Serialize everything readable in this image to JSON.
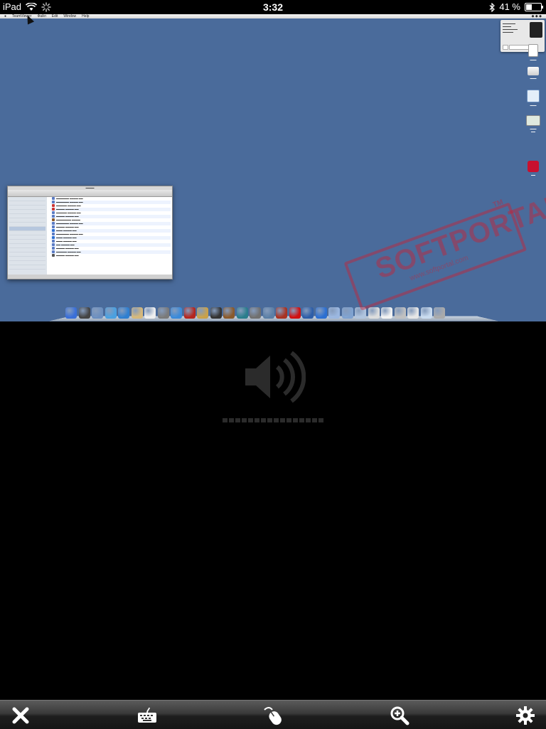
{
  "status_bar": {
    "device": "iPad",
    "time": "3:32",
    "battery": "41 %",
    "battery_level": 0.41
  },
  "remote_screen": {
    "menubar": {
      "items": [
        "TeamViewer",
        "Файл",
        "Edit",
        "Window",
        "Help"
      ]
    },
    "desktop_icons": [
      {
        "name": "document-icon",
        "color": "#ffffff"
      },
      {
        "name": "hard-drive-icon",
        "color": "#e0e0e0"
      },
      {
        "name": "disk-icon",
        "color": "#d9e7f5"
      },
      {
        "name": "screenshot-icon",
        "color": "#cfe2cf"
      },
      {
        "name": "pdf-app-icon",
        "color": "#c8102e"
      }
    ],
    "dock_colors": [
      "#3a6fd8",
      "#444444",
      "#6c8fbf",
      "#4aa0e0",
      "#2f7fd0",
      "#d6b87a",
      "#eeeeee",
      "#7a7a7a",
      "#3b8ad9",
      "#b5261e",
      "#c9a14a",
      "#333333",
      "#8a5a2b",
      "#2a7d8c",
      "#707070",
      "#5b7fa6",
      "#a83222",
      "#d01010",
      "#2e5ea8",
      "#2c6fd1",
      "#9bb7e0",
      "#7fa2d0",
      "#b0c4de",
      "#dddddd",
      "#f2f2f2",
      "#c0c0c0",
      "#e6e6e6",
      "#c9dbef",
      "#aaaaaa"
    ]
  },
  "watermark": {
    "title": "SOFTPORTAL",
    "tm": "TM",
    "url": "www.softportal.com"
  },
  "volume_hud": {
    "level": 0
  },
  "toolbar": {
    "close": "close-icon",
    "keyboard": "keyboard-icon",
    "mouse": "mouse-icon",
    "zoom": "zoom-icon",
    "settings": "gear-icon"
  }
}
